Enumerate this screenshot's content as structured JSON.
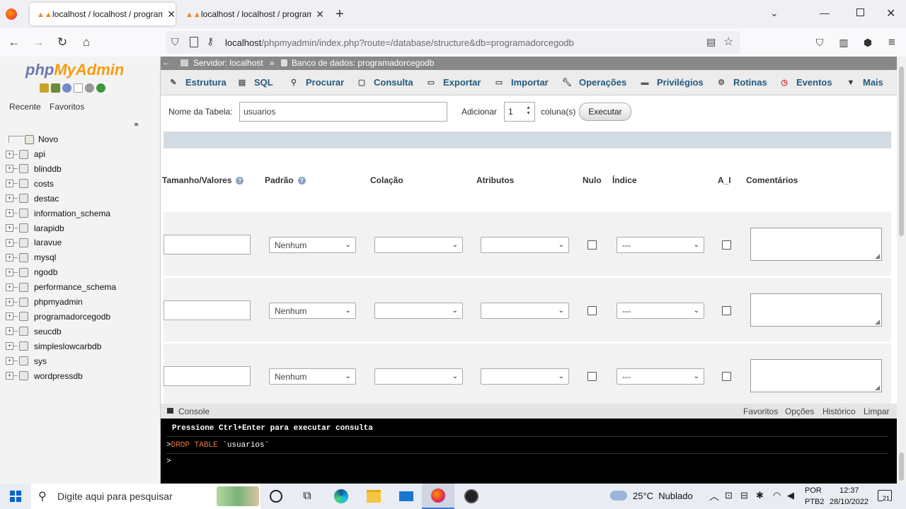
{
  "browser": {
    "tabs": [
      {
        "title": "localhost / localhost / programador"
      },
      {
        "title": "localhost / localhost / programador"
      }
    ],
    "url_host": "localhost",
    "url_path": "/phpmyadmin/index.php?route=/database/structure&db=programadorcegodb"
  },
  "sidebar": {
    "logo_php": "php",
    "logo_myadmin": "MyAdmin",
    "tab_recent": "Recente",
    "tab_favorites": "Favoritos",
    "new_label": "Novo",
    "databases": [
      "api",
      "blinddb",
      "costs",
      "destac",
      "information_schema",
      "larapidb",
      "laravue",
      "mysql",
      "ngodb",
      "performance_schema",
      "phpmyadmin",
      "programadorcegodb",
      "seucdb",
      "simpleslowcarbdb",
      "sys",
      "wordpressdb"
    ]
  },
  "breadcrumb": {
    "server": "Servidor: localhost",
    "database": "Banco de dados: programadorcegodb"
  },
  "menu": [
    "Estrutura",
    "SQL",
    "Procurar",
    "Consulta",
    "Exportar",
    "Importar",
    "Operações",
    "Privilégios",
    "Rotinas",
    "Eventos",
    "Mais"
  ],
  "form": {
    "table_name_label": "Nome da Tabela:",
    "table_name_value": "usuarios",
    "add_label": "Adicionar",
    "add_count": "1",
    "columns_label": "coluna(s)",
    "execute_button": "Executar"
  },
  "columns_header": {
    "size": "Tamanho/Valores",
    "default": "Padrão",
    "collation": "Colação",
    "attributes": "Atributos",
    "null": "Nulo",
    "index": "Índice",
    "ai": "A_I",
    "comments": "Comentários"
  },
  "rows": [
    {
      "default": "Nenhum",
      "index": "---"
    },
    {
      "default": "Nenhum",
      "index": "---"
    },
    {
      "default": "Nenhum",
      "index": "---"
    }
  ],
  "console": {
    "label": "Console",
    "links": [
      "Favoritos",
      "Opções",
      "Histórico",
      "Limpar"
    ],
    "hint": "Pressione Ctrl+Enter para executar consulta",
    "query_keyword": "DROP TABLE",
    "query_rest": " `usuarios`",
    "prompt": ">"
  },
  "taskbar": {
    "search_placeholder": "Digite aqui para pesquisar",
    "weather": "25°C  Nublado",
    "lang_top": "POR",
    "lang_bottom": "PTB2",
    "time": "12:37",
    "date": "28/10/2022",
    "notif_count": "21"
  }
}
